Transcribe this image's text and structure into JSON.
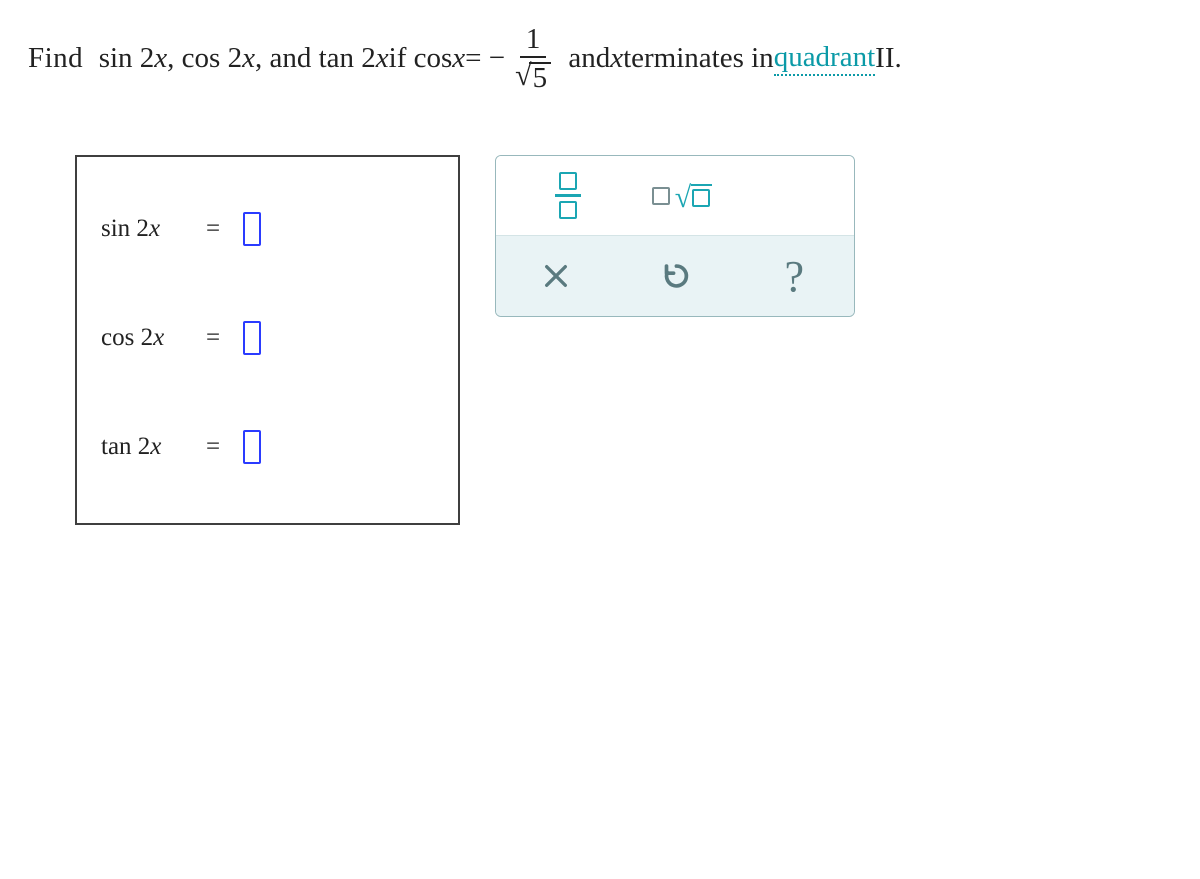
{
  "problem": {
    "prefix": "Find  ",
    "term1": "sin 2",
    "sep1": ", ",
    "term2": "cos 2",
    "sep2": ", and ",
    "term3": "tan 2",
    "mid": " if ",
    "cosx": "cos",
    "after_cos": " = −",
    "frac_num": "1",
    "frac_radicand": "5",
    "tail1": " and ",
    "x": "x",
    "tail2": " terminates in ",
    "link_text": "quadrant",
    "tail3": " II."
  },
  "answers": {
    "rows": [
      {
        "label": "sin 2",
        "var": "x",
        "eq": "="
      },
      {
        "label": "cos 2",
        "var": "x",
        "eq": "="
      },
      {
        "label": "tan 2",
        "var": "x",
        "eq": "="
      }
    ]
  },
  "palette": {
    "fraction_tool": "fraction",
    "sqrt_tool": "nth-root",
    "clear": "clear",
    "undo": "undo",
    "help": "?"
  }
}
